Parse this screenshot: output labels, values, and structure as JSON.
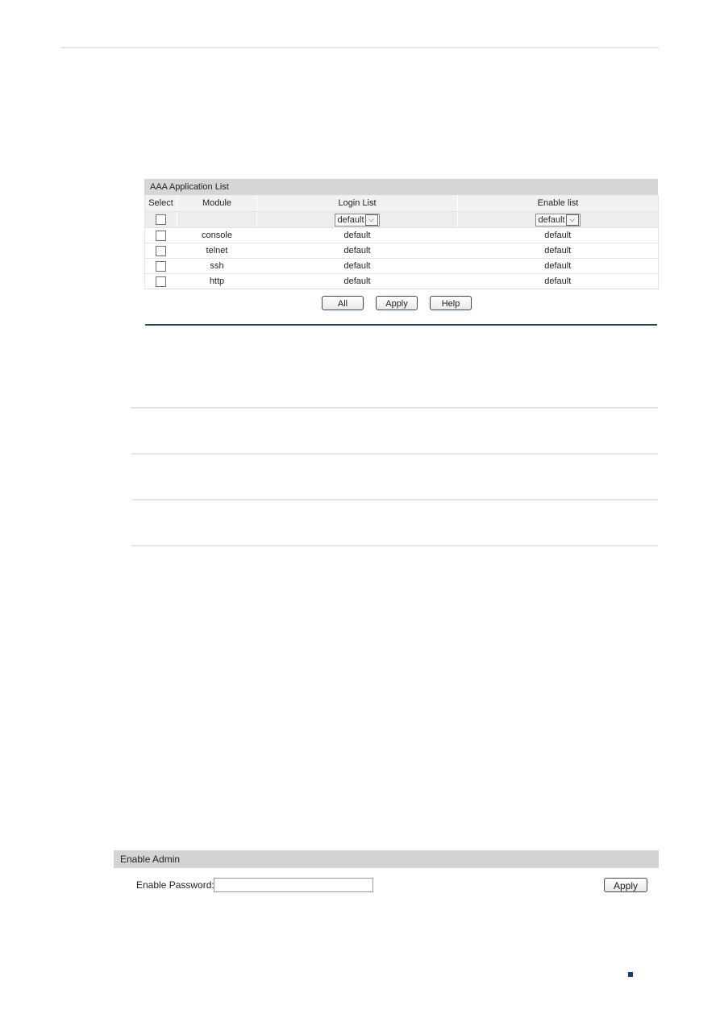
{
  "aaa_application_list": {
    "title": "AAA Application List",
    "columns": [
      "Select",
      "Module",
      "Login List",
      "Enable list"
    ],
    "bulk_row": {
      "login_list_select": "default",
      "enable_list_select": "default"
    },
    "rows": [
      {
        "module": "console",
        "login_list": "default",
        "enable_list": "default"
      },
      {
        "module": "telnet",
        "login_list": "default",
        "enable_list": "default"
      },
      {
        "module": "ssh",
        "login_list": "default",
        "enable_list": "default"
      },
      {
        "module": "http",
        "login_list": "default",
        "enable_list": "default"
      }
    ],
    "buttons": {
      "all": "All",
      "apply": "Apply",
      "help": "Help"
    }
  },
  "enable_admin": {
    "title": "Enable Admin",
    "password_label": "Enable Password:",
    "password_value": "",
    "apply": "Apply"
  },
  "colors": {
    "section_header": "#d6d6d6",
    "rule_accent": "#1f4f5f",
    "page_marker": "#1a3a7a"
  }
}
